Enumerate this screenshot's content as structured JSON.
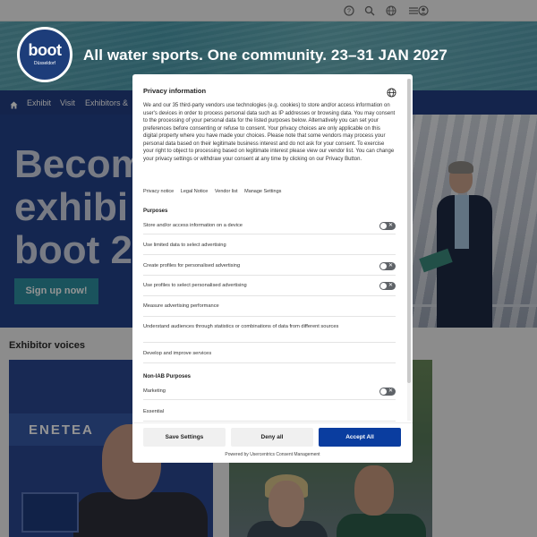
{
  "banner": {
    "logo_word": "boot",
    "logo_sub": "Düsseldorf",
    "tagline": "All water sports. One community. 23–31 JAN 2027"
  },
  "nav": {
    "items": [
      "Exhibit",
      "Visit",
      "Exhibitors &"
    ]
  },
  "hero": {
    "title_lines": [
      "Becom",
      "exhibi",
      "boot 2"
    ],
    "signup_label": "Sign up now!"
  },
  "section": {
    "title": "Exhibitor voices",
    "card1_brand": "ENETEA"
  },
  "consent": {
    "title": "Privacy information",
    "body": "We and our 35 third-party vendors use technologies (e.g. cookies) to store and/or access information on user's devices in order to process personal data such as IP addresses or browsing data. You may consent to the processing of your personal data for the listed purposes below. Alternatively you can set your preferences before consenting or refuse to consent. Your privacy choices are only applicable on this digital property where you have made your choices. Please note that some vendors may process your personal data based on their legitimate business interest and do not ask for your consent. To exercise your right to object to processing based on legitimate interest please view our vendor list. You can change your privacy settings or withdraw your consent at any time by clicking on our Privacy Button.",
    "links": [
      "Privacy notice",
      "Legal Notice",
      "Vendor list",
      "Manage Settings"
    ],
    "purposes_title": "Purposes",
    "purposes": [
      {
        "label": "Store and/or access information on a device",
        "toggle": true
      },
      {
        "label": "Use limited data to select advertising",
        "toggle": false
      },
      {
        "label": "Create profiles for personalised advertising",
        "toggle": true
      },
      {
        "label": "Use profiles to select personalised advertising",
        "toggle": true
      },
      {
        "label": "Measure advertising performance",
        "toggle": false
      },
      {
        "label": "Understand audiences through statistics or combinations of data from different sources",
        "toggle": false
      },
      {
        "label": "Develop and improve services",
        "toggle": false
      }
    ],
    "non_iab_title": "Non-IAB Purposes",
    "non_iab": [
      {
        "label": "Marketing",
        "toggle": true
      },
      {
        "label": "Essential",
        "toggle": false
      }
    ],
    "buttons": {
      "save": "Save Settings",
      "deny": "Deny all",
      "accept": "Accept All"
    },
    "powered_by": "Powered by Usercentrics Consent Management"
  },
  "colors": {
    "navy": "#233f84",
    "teal": "#2d8fa0",
    "accept_blue": "#0a3d9f"
  }
}
